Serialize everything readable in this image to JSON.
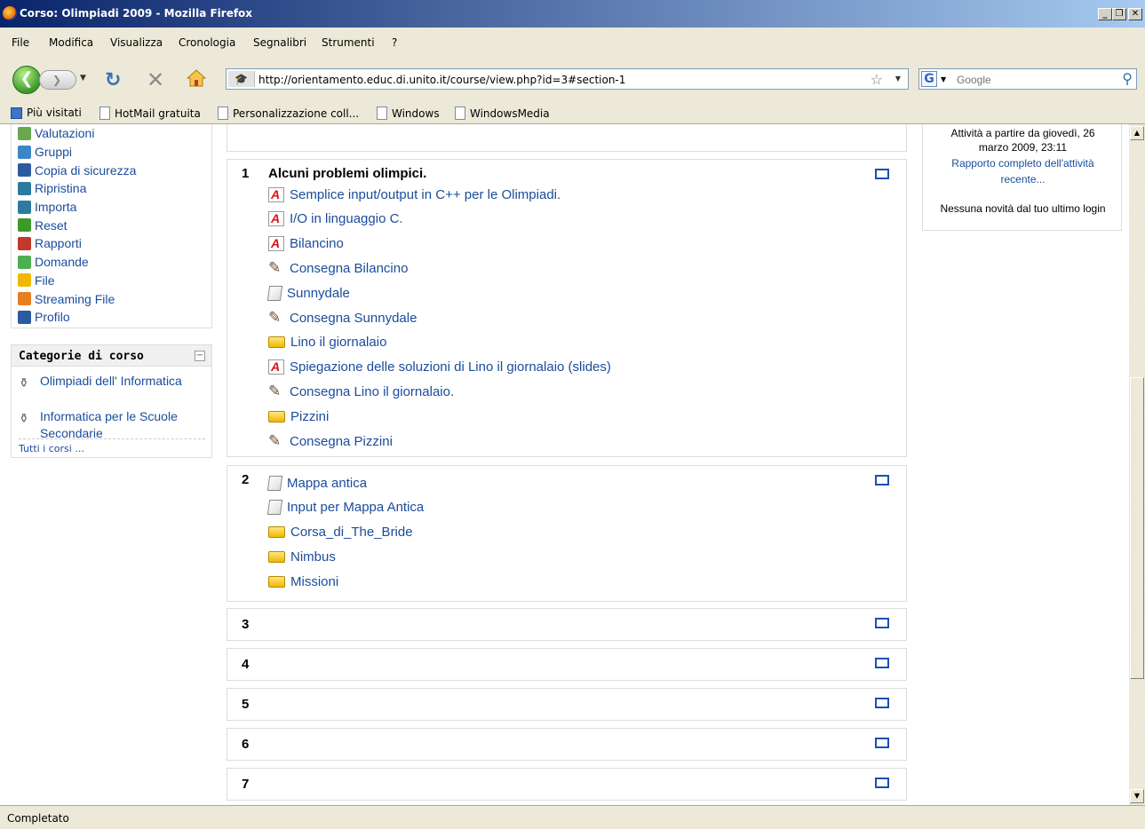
{
  "window": {
    "title": "Corso: Olimpiadi 2009 - Mozilla Firefox",
    "minimize": "_",
    "maximize": "❐",
    "close": "✕"
  },
  "menu": [
    "File",
    "Modifica",
    "Visualizza",
    "Cronologia",
    "Segnalibri",
    "Strumenti",
    "?"
  ],
  "nav": {
    "url": "http://orientamento.educ.di.unito.it/course/view.php?id=3#section-1",
    "search_placeholder": "Google",
    "search_engine_letter": "G"
  },
  "bookmarks": [
    "Più visitati",
    "HotMail gratuita",
    "Personalizzazione coll...",
    "Windows",
    "WindowsMedia"
  ],
  "admin": {
    "items": [
      {
        "label": "Valutazioni",
        "icon": "grades-icon",
        "color": "#6aa84f"
      },
      {
        "label": "Gruppi",
        "icon": "groups-icon",
        "color": "#3d85c6"
      },
      {
        "label": "Copia di sicurezza",
        "icon": "backup-icon",
        "color": "#2c5aa0"
      },
      {
        "label": "Ripristina",
        "icon": "restore-icon",
        "color": "#2c7aa0"
      },
      {
        "label": "Importa",
        "icon": "import-icon",
        "color": "#2c7aa0"
      },
      {
        "label": "Reset",
        "icon": "reset-icon",
        "color": "#3c9a2a"
      },
      {
        "label": "Rapporti",
        "icon": "reports-icon",
        "color": "#c0392b"
      },
      {
        "label": "Domande",
        "icon": "questions-icon",
        "color": "#4caf50"
      },
      {
        "label": "File",
        "icon": "folder-icon",
        "color": "#f0b800"
      },
      {
        "label": "Streaming File",
        "icon": "streaming-icon",
        "color": "#e67e22"
      },
      {
        "label": "Profilo",
        "icon": "profile-icon",
        "color": "#2c5aa0"
      }
    ]
  },
  "categories": {
    "title": "Categorie di corso",
    "collapse": "−",
    "items": [
      "Olimpiadi dell' Informatica",
      "Informatica per le Scuole Secondarie"
    ],
    "all": "Tutti i corsi ..."
  },
  "sections": [
    {
      "number": "1",
      "title": "Alcuni problemi olimpici.",
      "activities": [
        {
          "label": "Semplice input/output in C++ per le Olimpiadi.",
          "type": "pdf"
        },
        {
          "label": "I/O in linguaggio C.",
          "type": "pdf"
        },
        {
          "label": "Bilancino",
          "type": "pdf"
        },
        {
          "label": "Consegna Bilancino",
          "type": "assign"
        },
        {
          "label": "Sunnydale",
          "type": "page"
        },
        {
          "label": "Consegna Sunnydale",
          "type": "assign"
        },
        {
          "label": "Lino il giornalaio",
          "type": "folder"
        },
        {
          "label": "Spiegazione delle soluzioni di Lino il giornalaio (slides)",
          "type": "pdf"
        },
        {
          "label": "Consegna Lino il giornalaio.",
          "type": "assign"
        },
        {
          "label": "Pizzini",
          "type": "folder"
        },
        {
          "label": "Consegna Pizzini",
          "type": "assign"
        }
      ]
    },
    {
      "number": "2",
      "title": "",
      "activities": [
        {
          "label": "Mappa antica",
          "type": "page"
        },
        {
          "label": "Input per Mappa Antica",
          "type": "page"
        },
        {
          "label": "Corsa_di_The_Bride",
          "type": "folder"
        },
        {
          "label": "Nimbus",
          "type": "folder"
        },
        {
          "label": "Missioni",
          "type": "folder"
        }
      ]
    },
    {
      "number": "3",
      "title": "",
      "activities": []
    },
    {
      "number": "4",
      "title": "",
      "activities": []
    },
    {
      "number": "5",
      "title": "",
      "activities": []
    },
    {
      "number": "6",
      "title": "",
      "activities": []
    },
    {
      "number": "7",
      "title": "",
      "activities": []
    }
  ],
  "recent": {
    "since": "Attività a partire da giovedì, 26 marzo 2009, 23:11",
    "since_line1": "Attività a partire da giovedì, 26",
    "since_line2": "marzo 2009, 23:11",
    "full_report_line1": "Rapporto completo dell'attività",
    "full_report_line2": "recente...",
    "no_news": "Nessuna novità dal tuo ultimo login"
  },
  "status": "Completato"
}
